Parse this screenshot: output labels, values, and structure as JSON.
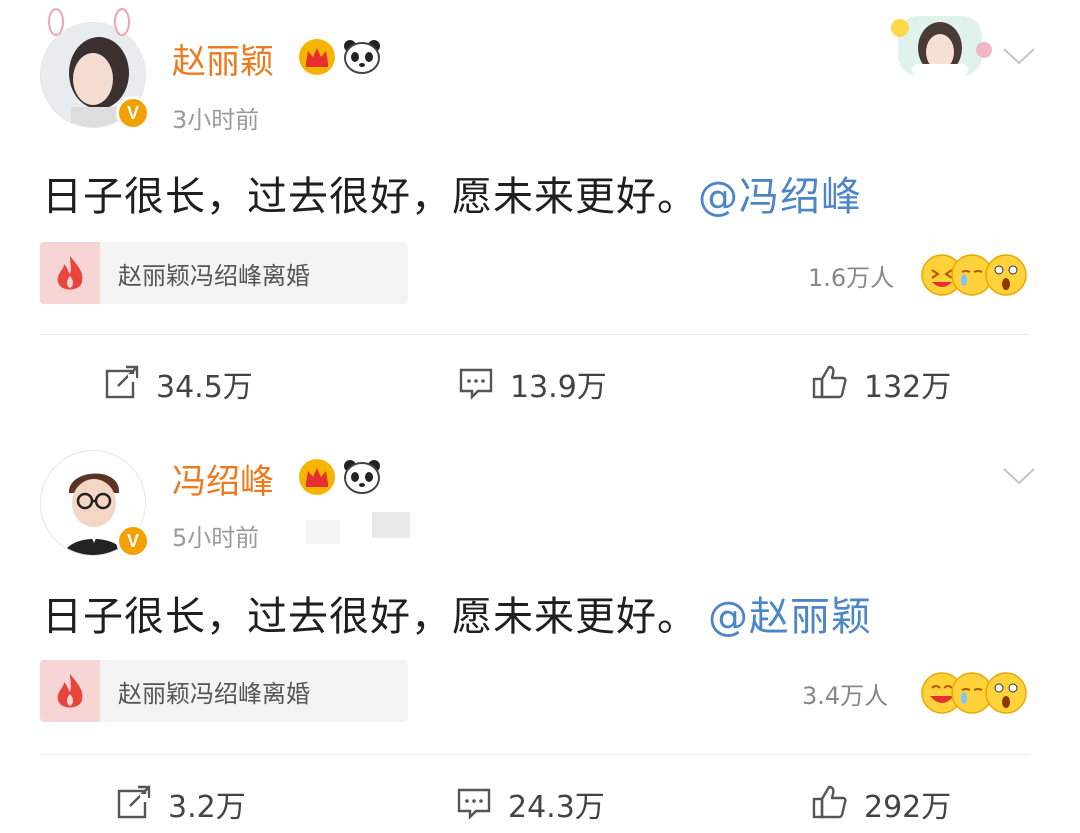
{
  "posts": [
    {
      "username": "赵丽颖",
      "time": "3小时前",
      "content_text": "日子很长，过去很好，愿未来更好。",
      "mention": "@冯绍峰",
      "topic": "赵丽颖冯绍峰离婚",
      "reaction_count": "1.6万人",
      "repost": "34.5万",
      "comment": "13.9万",
      "like": "132万",
      "verified_badge": "V"
    },
    {
      "username": "冯绍峰",
      "time": "5小时前",
      "content_text": "日子很长，过去很好，愿未来更好。",
      "mention": "@赵丽颖",
      "topic": "赵丽颖冯绍峰离婚",
      "reaction_count": "3.4万人",
      "repost": "3.2万",
      "comment": "24.3万",
      "like": "292万",
      "verified_badge": "V"
    }
  ],
  "colors": {
    "username": "#ee7a1e",
    "mention": "#4d86c7",
    "verified": "#f2a100",
    "hot_icon": "#e8453c"
  },
  "icons": [
    "crown-icon",
    "panda-icon",
    "chevron-down-icon",
    "fire-icon",
    "repost-icon",
    "comment-icon",
    "like-icon",
    "emoji-reaction-icons"
  ]
}
